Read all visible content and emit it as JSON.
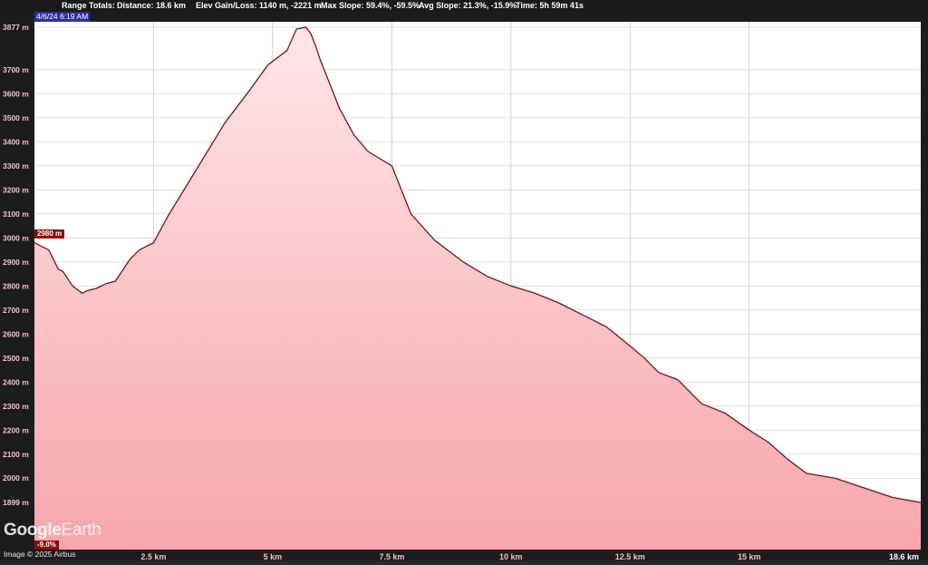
{
  "header": {
    "range_label": "Range Totals:",
    "distance": "Distance: 18.6 km",
    "elevation": "Elev Gain/Loss: 1140 m, -2221 m",
    "max_slope": "Max Slope: 59.4%, -59.5%",
    "avg_slope": "Avg Slope: 21.3%, -15.9%",
    "time": "Time: 5h 59m 41s"
  },
  "cursor": {
    "timestamp": "4/6/24 6:19 AM",
    "elevation_badge": "2980 m",
    "slope_badge": "-9.0%"
  },
  "branding": {
    "logo_google": "Google",
    "logo_earth": "Earth",
    "credit": "Image © 2025 Airbus"
  },
  "colors": {
    "line": "#7a1212",
    "fill_top": "#ffe6e9",
    "fill_bottom": "#f6a6ab",
    "plot_bg": "#ffffff",
    "grid": "#cfc4c4"
  },
  "chart_data": {
    "type": "area",
    "title": "",
    "xlabel": "",
    "ylabel": "",
    "xlim": [
      0,
      18.6
    ],
    "ylim": [
      1899,
      3877
    ],
    "x_ticks": [
      2.5,
      5,
      7.5,
      10,
      12.5,
      15,
      18.6
    ],
    "x_tick_labels": [
      "2.5 km",
      "5 km",
      "7.5 km",
      "10 km",
      "12.5 km",
      "15 km",
      "18.6 km"
    ],
    "y_ticks": [
      1899,
      2000,
      2100,
      2200,
      2300,
      2400,
      2500,
      2600,
      2700,
      2800,
      2900,
      3000,
      3100,
      3200,
      3300,
      3400,
      3500,
      3600,
      3700,
      3877
    ],
    "y_tick_labels": [
      "1899 m",
      "2000 m",
      "2100 m",
      "2200 m",
      "2300 m",
      "2400 m",
      "2500 m",
      "2600 m",
      "2700 m",
      "2800 m",
      "2900 m",
      "3000 m",
      "3100 m",
      "3200 m",
      "3300 m",
      "3400 m",
      "3500 m",
      "3600 m",
      "3700 m",
      "3877 m"
    ],
    "series": [
      {
        "x": [
          0,
          0.3,
          0.5,
          0.6,
          0.8,
          1.0,
          1.1,
          1.3,
          1.5,
          1.7,
          2.0,
          2.2,
          2.5,
          2.8,
          3.2,
          3.6,
          4.0,
          4.5,
          4.9,
          5.3,
          5.5,
          5.7,
          5.8,
          5.9,
          6.0,
          6.2,
          6.4,
          6.7,
          7.0,
          7.5,
          7.9,
          8.4,
          9.0,
          9.5,
          10.0,
          10.5,
          11.0,
          11.5,
          12.0,
          12.5,
          12.8,
          13.1,
          13.5,
          14.0,
          14.5,
          15.0,
          15.4,
          15.8,
          16.2,
          16.8,
          17.4,
          18.0,
          18.6
        ],
        "y": [
          2980,
          2950,
          2870,
          2860,
          2800,
          2770,
          2780,
          2790,
          2810,
          2820,
          2910,
          2950,
          2980,
          3090,
          3220,
          3350,
          3480,
          3610,
          3720,
          3780,
          3870,
          3877,
          3850,
          3800,
          3740,
          3640,
          3540,
          3430,
          3360,
          3300,
          3100,
          2990,
          2900,
          2840,
          2800,
          2770,
          2730,
          2680,
          2630,
          2550,
          2500,
          2440,
          2410,
          2310,
          2270,
          2200,
          2150,
          2080,
          2020,
          2000,
          1960,
          1920,
          1899
        ]
      }
    ],
    "grid": true,
    "legend": "none"
  }
}
